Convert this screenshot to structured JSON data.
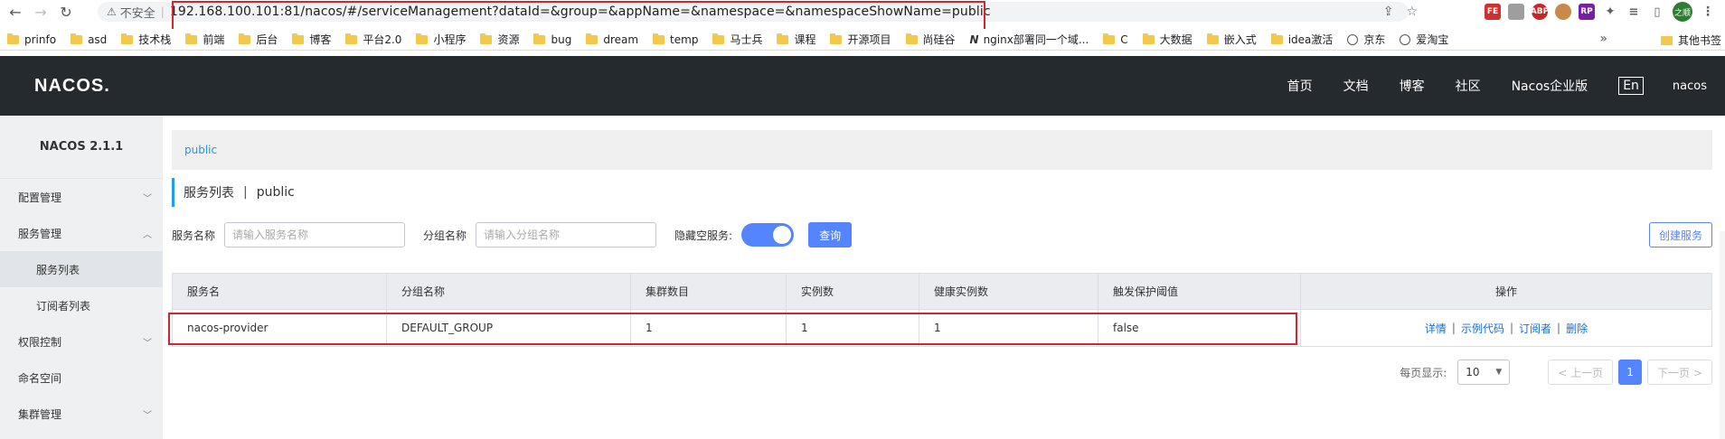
{
  "browser": {
    "insecure_label": "不安全",
    "url": "192.168.100.101:81/nacos/#/serviceManagement?dataId=&group=&appName=&namespace=&namespaceShowName=public",
    "extensions": [
      "FE",
      "ABP",
      "RP"
    ],
    "profile_label": "之顺"
  },
  "bookmarks": [
    {
      "label": "prinfo",
      "icon": "folder"
    },
    {
      "label": "asd",
      "icon": "folder"
    },
    {
      "label": "技术栈",
      "icon": "folder"
    },
    {
      "label": "前端",
      "icon": "folder"
    },
    {
      "label": "后台",
      "icon": "folder"
    },
    {
      "label": "博客",
      "icon": "folder"
    },
    {
      "label": "平台2.0",
      "icon": "folder"
    },
    {
      "label": "小程序",
      "icon": "folder"
    },
    {
      "label": "资源",
      "icon": "folder"
    },
    {
      "label": "bug",
      "icon": "folder"
    },
    {
      "label": "dream",
      "icon": "folder"
    },
    {
      "label": "temp",
      "icon": "folder"
    },
    {
      "label": "马士兵",
      "icon": "folder"
    },
    {
      "label": "课程",
      "icon": "folder"
    },
    {
      "label": "开源项目",
      "icon": "folder"
    },
    {
      "label": "尚硅谷",
      "icon": "folder"
    },
    {
      "label": "nginx部署同一个域...",
      "icon": "nginx"
    },
    {
      "label": "C",
      "icon": "folder"
    },
    {
      "label": "大数据",
      "icon": "folder"
    },
    {
      "label": "嵌入式",
      "icon": "folder"
    },
    {
      "label": "idea激活",
      "icon": "folder"
    },
    {
      "label": "京东",
      "icon": "globe"
    },
    {
      "label": "爱淘宝",
      "icon": "globe"
    }
  ],
  "bookmarks_more": "»",
  "bookmarks_other": "其他书签",
  "header": {
    "logo": "NACOS.",
    "nav": [
      "首页",
      "文档",
      "博客",
      "社区",
      "Nacos企业版"
    ],
    "lang": "En",
    "user": "nacos"
  },
  "sidebar": {
    "title": "NACOS 2.1.1",
    "items": [
      {
        "label": "配置管理",
        "expand": "down"
      },
      {
        "label": "服务管理",
        "expand": "up"
      },
      {
        "label": "服务列表",
        "sub": true,
        "active": true
      },
      {
        "label": "订阅者列表",
        "sub": true
      },
      {
        "label": "权限控制",
        "expand": "down"
      },
      {
        "label": "命名空间"
      },
      {
        "label": "集群管理",
        "expand": "down"
      }
    ]
  },
  "main": {
    "namespace": "public",
    "title": "服务列表",
    "title_sep": "|",
    "title_ns": "public",
    "filters": {
      "service_label": "服务名称",
      "service_placeholder": "请输入服务名称",
      "group_label": "分组名称",
      "group_placeholder": "请输入分组名称",
      "hide_empty_label": "隐藏空服务:",
      "hide_empty_on": true,
      "query_button": "查询",
      "create_button": "创建服务"
    },
    "table": {
      "columns": [
        "服务名",
        "分组名称",
        "集群数目",
        "实例数",
        "健康实例数",
        "触发保护阈值",
        "操作"
      ],
      "rows": [
        {
          "service": "nacos-provider",
          "group": "DEFAULT_GROUP",
          "clusters": "1",
          "instances": "1",
          "healthy": "1",
          "threshold": "false",
          "ops": [
            "详情",
            "示例代码",
            "订阅者",
            "删除"
          ]
        }
      ]
    },
    "pager": {
      "per_page_label": "每页显示:",
      "per_page": "10",
      "prev": "< 上一页",
      "current": "1",
      "next": "下一页 >"
    }
  }
}
